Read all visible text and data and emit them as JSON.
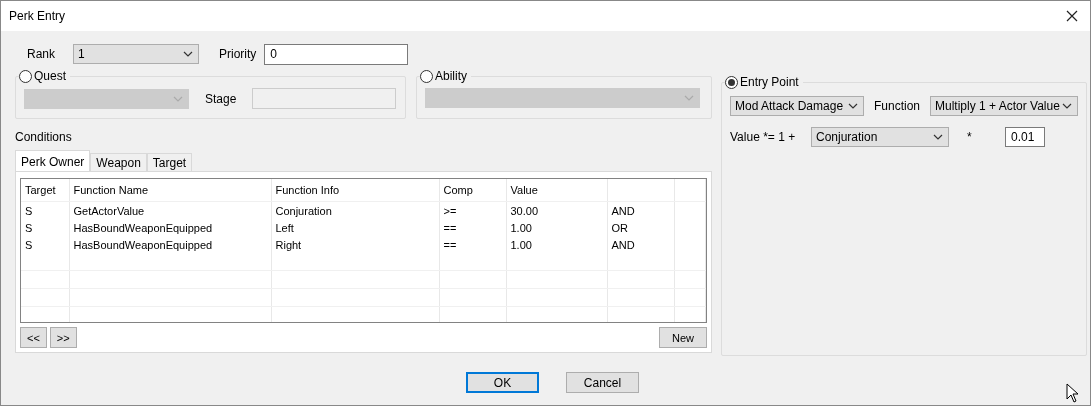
{
  "window": {
    "title": "Perk Entry"
  },
  "rank": {
    "label": "Rank",
    "value": "1"
  },
  "priority": {
    "label": "Priority",
    "value": "0"
  },
  "quest": {
    "label": "Quest",
    "selected": false,
    "disabled": true,
    "stage_label": "Stage"
  },
  "ability": {
    "label": "Ability",
    "selected": false,
    "disabled": true
  },
  "entry_point": {
    "label": "Entry Point",
    "selected": true,
    "entry": "Mod Attack Damage",
    "function_label": "Function",
    "function": "Multiply 1 + Actor Value",
    "value_label": "Value *= 1 +",
    "actor_value": "Conjuration",
    "times_label": "*",
    "multiplier": "0.01"
  },
  "conditions": {
    "label": "Conditions",
    "tabs": [
      {
        "label": "Perk Owner",
        "selected": true
      },
      {
        "label": "Weapon",
        "selected": false
      },
      {
        "label": "Target",
        "selected": false
      }
    ],
    "columns": [
      "Target",
      "Function Name",
      "Function Info",
      "Comp",
      "Value"
    ],
    "rows": [
      {
        "target": "S",
        "function_name": "GetActorValue",
        "function_info": "Conjuration",
        "comp": ">=",
        "value": "30.00",
        "column_6": "AND"
      },
      {
        "target": "S",
        "function_name": "HasBoundWeaponEquipped",
        "function_info": "Left",
        "comp": "==",
        "value": "1.00",
        "column_6": "OR"
      },
      {
        "target": "S",
        "function_name": "HasBoundWeaponEquipped",
        "function_info": "Right",
        "comp": "==",
        "value": "1.00",
        "column_6": "AND"
      }
    ],
    "buttons": [
      "<<",
      ">>",
      "New"
    ]
  },
  "buttons": [
    {
      "label": "OK",
      "default": true
    },
    {
      "label": "Cancel",
      "default": false
    }
  ]
}
